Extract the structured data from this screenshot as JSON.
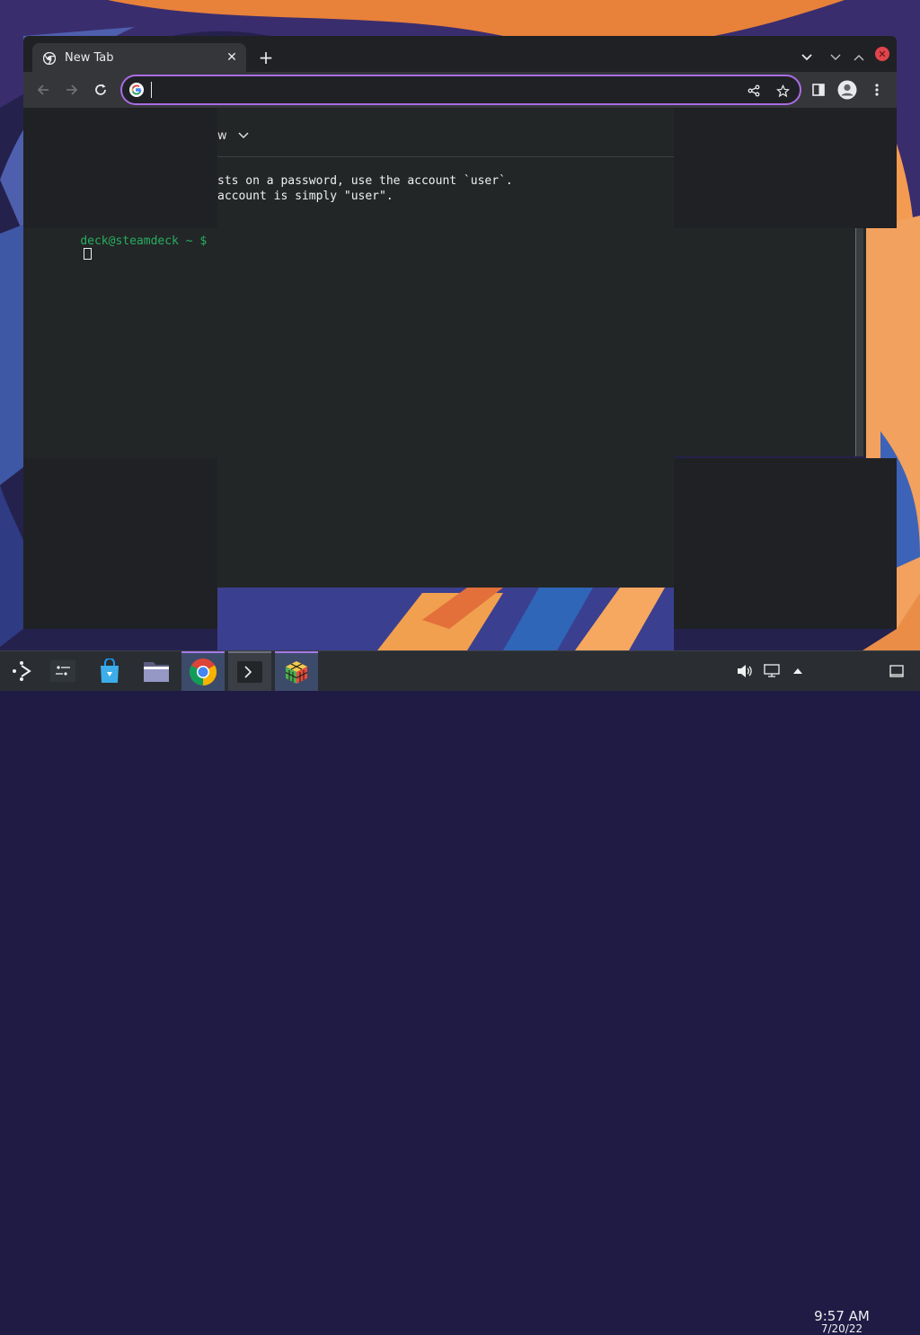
{
  "browser": {
    "tab_title": "New Tab",
    "omnibox_value": "",
    "accent": "#a96de4"
  },
  "terminal": {
    "view_label": "w",
    "line1": "sts on a password, use the account `user`.",
    "line2": "account is simply \"user\".",
    "prompt": "deck@steamdeck ~ $"
  },
  "taskbar": {
    "time": "9:57 AM",
    "date": "7/20/22",
    "items": [
      "application-launcher-icon",
      "task-manager-icon",
      "discover-icon",
      "dolphin-icon",
      "chrome-icon",
      "konsole-icon",
      "game-icon"
    ]
  },
  "colors": {
    "chrome_bg": "#202124",
    "toolbar_bg": "#35363a",
    "taskbar_bg": "#2a2e32",
    "prompt_green": "#27ae60"
  }
}
